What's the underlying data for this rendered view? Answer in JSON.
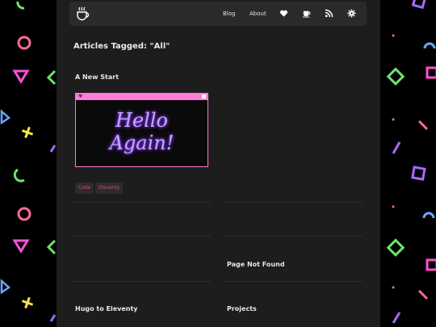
{
  "nav": {
    "logo_icon": "coffee-cup-icon",
    "links": [
      "Blog",
      "About"
    ],
    "icons": [
      "heart-icon",
      "coffee-icon",
      "rss-icon",
      "gear-icon"
    ]
  },
  "page": {
    "heading": "Articles Tagged: \"All\""
  },
  "posts": [
    {
      "title": "A New Start",
      "image_text": [
        "Hello",
        "Again!"
      ],
      "tags": [
        "Code",
        "Eleventy"
      ]
    },
    {
      "title": "Page Not Found"
    },
    {
      "title": "Hugo to Eleventy"
    },
    {
      "title": "Projects"
    }
  ],
  "colors": {
    "page_bg": "#000000",
    "main_bg": "#1d1d1d",
    "nav_bg": "#2a2a2a",
    "accent_pink": "#ff7bd5",
    "tag_text": "#d14f6b"
  }
}
